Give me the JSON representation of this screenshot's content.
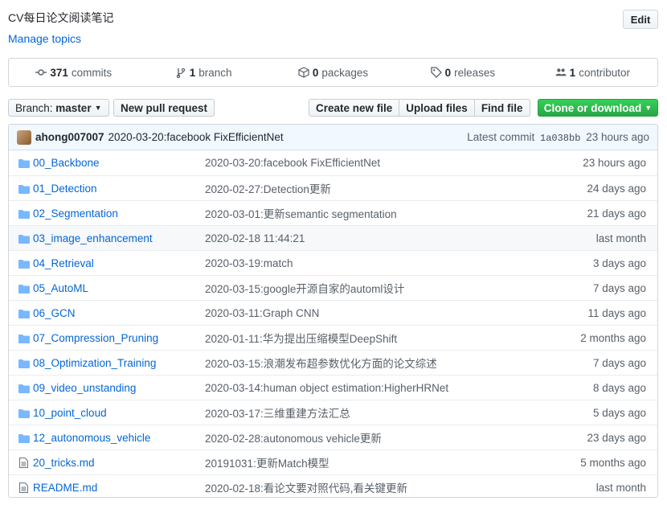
{
  "repo": {
    "description": "CV每日论文阅读笔记",
    "manage_topics": "Manage topics",
    "edit_label": "Edit"
  },
  "summary": {
    "commits_count": "371",
    "commits_label": "commits",
    "branch_count": "1",
    "branch_label": "branch",
    "packages_count": "0",
    "packages_label": "packages",
    "releases_count": "0",
    "releases_label": "releases",
    "contributor_count": "1",
    "contributor_label": "contributor"
  },
  "toolbar": {
    "branch_prefix": "Branch:",
    "branch_name": "master",
    "new_pull_request": "New pull request",
    "create_new_file": "Create new file",
    "upload_files": "Upload files",
    "find_file": "Find file",
    "clone_or_download": "Clone or download"
  },
  "latest_commit": {
    "author": "ahong007007",
    "message": "2020-03-20:facebook FixEfficientNet",
    "label": "Latest commit",
    "sha": "1a038bb",
    "age": "23 hours ago"
  },
  "files": [
    {
      "type": "dir",
      "name": "00_Backbone",
      "message": "2020-03-20:facebook FixEfficientNet",
      "age": "23 hours ago"
    },
    {
      "type": "dir",
      "name": "01_Detection",
      "message": "2020-02-27:Detection更新",
      "age": "24 days ago"
    },
    {
      "type": "dir",
      "name": "02_Segmentation",
      "message": "2020-03-01:更新semantic segmentation",
      "age": "21 days ago"
    },
    {
      "type": "dir",
      "name": "03_image_enhancement",
      "message": "2020-02-18 11:44:21",
      "age": "last month"
    },
    {
      "type": "dir",
      "name": "04_Retrieval",
      "message": "2020-03-19:match",
      "age": "3 days ago"
    },
    {
      "type": "dir",
      "name": "05_AutoML",
      "message": "2020-03-15:google开源自家的automl设计",
      "age": "7 days ago"
    },
    {
      "type": "dir",
      "name": "06_GCN",
      "message": "2020-03-11:Graph CNN",
      "age": "11 days ago"
    },
    {
      "type": "dir",
      "name": "07_Compression_Pruning",
      "message": "2020-01-11:华为提出压缩模型DeepShift",
      "age": "2 months ago"
    },
    {
      "type": "dir",
      "name": "08_Optimization_Training",
      "message": "2020-03-15:浪潮发布超参数优化方面的论文综述",
      "age": "7 days ago"
    },
    {
      "type": "dir",
      "name": "09_video_unstanding",
      "message": "2020-03-14:human object estimation:HigherHRNet",
      "age": "8 days ago"
    },
    {
      "type": "dir",
      "name": "10_point_cloud",
      "message": "2020-03-17:三维重建方法汇总",
      "age": "5 days ago"
    },
    {
      "type": "dir",
      "name": "12_autonomous_vehicle",
      "message": "2020-02-28:autonomous vehicle更新",
      "age": "23 days ago"
    },
    {
      "type": "file",
      "name": "20_tricks.md",
      "message": "20191031:更新Match模型",
      "age": "5 months ago"
    },
    {
      "type": "file",
      "name": "README.md",
      "message": "2020-02-18:看论文要对照代码,看关键更新",
      "age": "last month"
    }
  ],
  "colors": {
    "link": "#0366d6",
    "folder": "#79b8ff",
    "clone_green": "#28a745"
  }
}
